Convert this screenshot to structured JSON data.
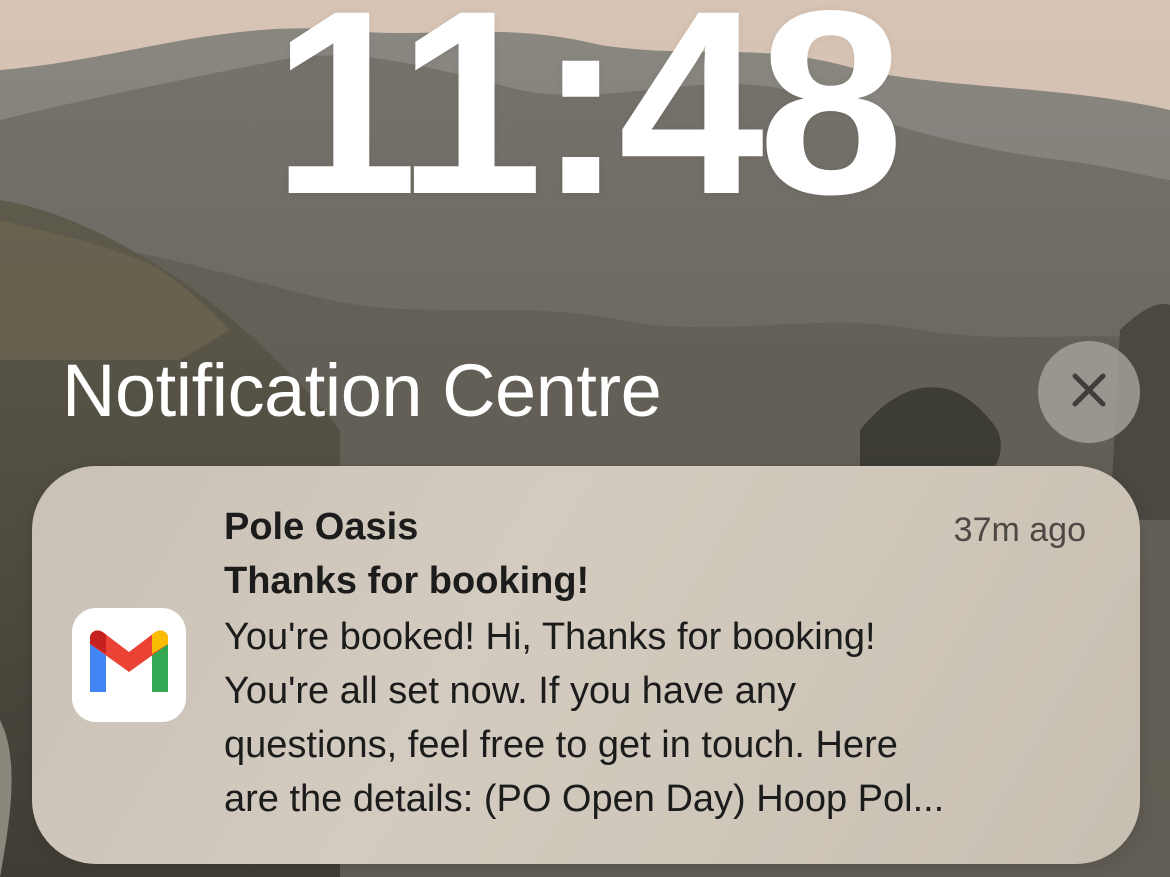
{
  "lock_screen": {
    "time": "11:48"
  },
  "notification_centre": {
    "title": "Notification Centre",
    "close_icon": "close-icon"
  },
  "notifications": [
    {
      "app_icon": "gmail-icon",
      "sender": "Pole Oasis",
      "time_ago": "37m ago",
      "subject": "Thanks for booking!",
      "body_lines": [
        "You're booked! Hi, Thanks for booking!",
        "You're all set now. If you have any",
        "questions, feel free to get in touch. Here",
        "are the details: (PO Open Day) Hoop Pol..."
      ]
    }
  ],
  "colors": {
    "gmail_red": "#EA4335",
    "gmail_blue": "#4285F4",
    "gmail_green": "#34A853",
    "gmail_yellow": "#FBBC04",
    "gmail_dark_red": "#C5221F"
  }
}
